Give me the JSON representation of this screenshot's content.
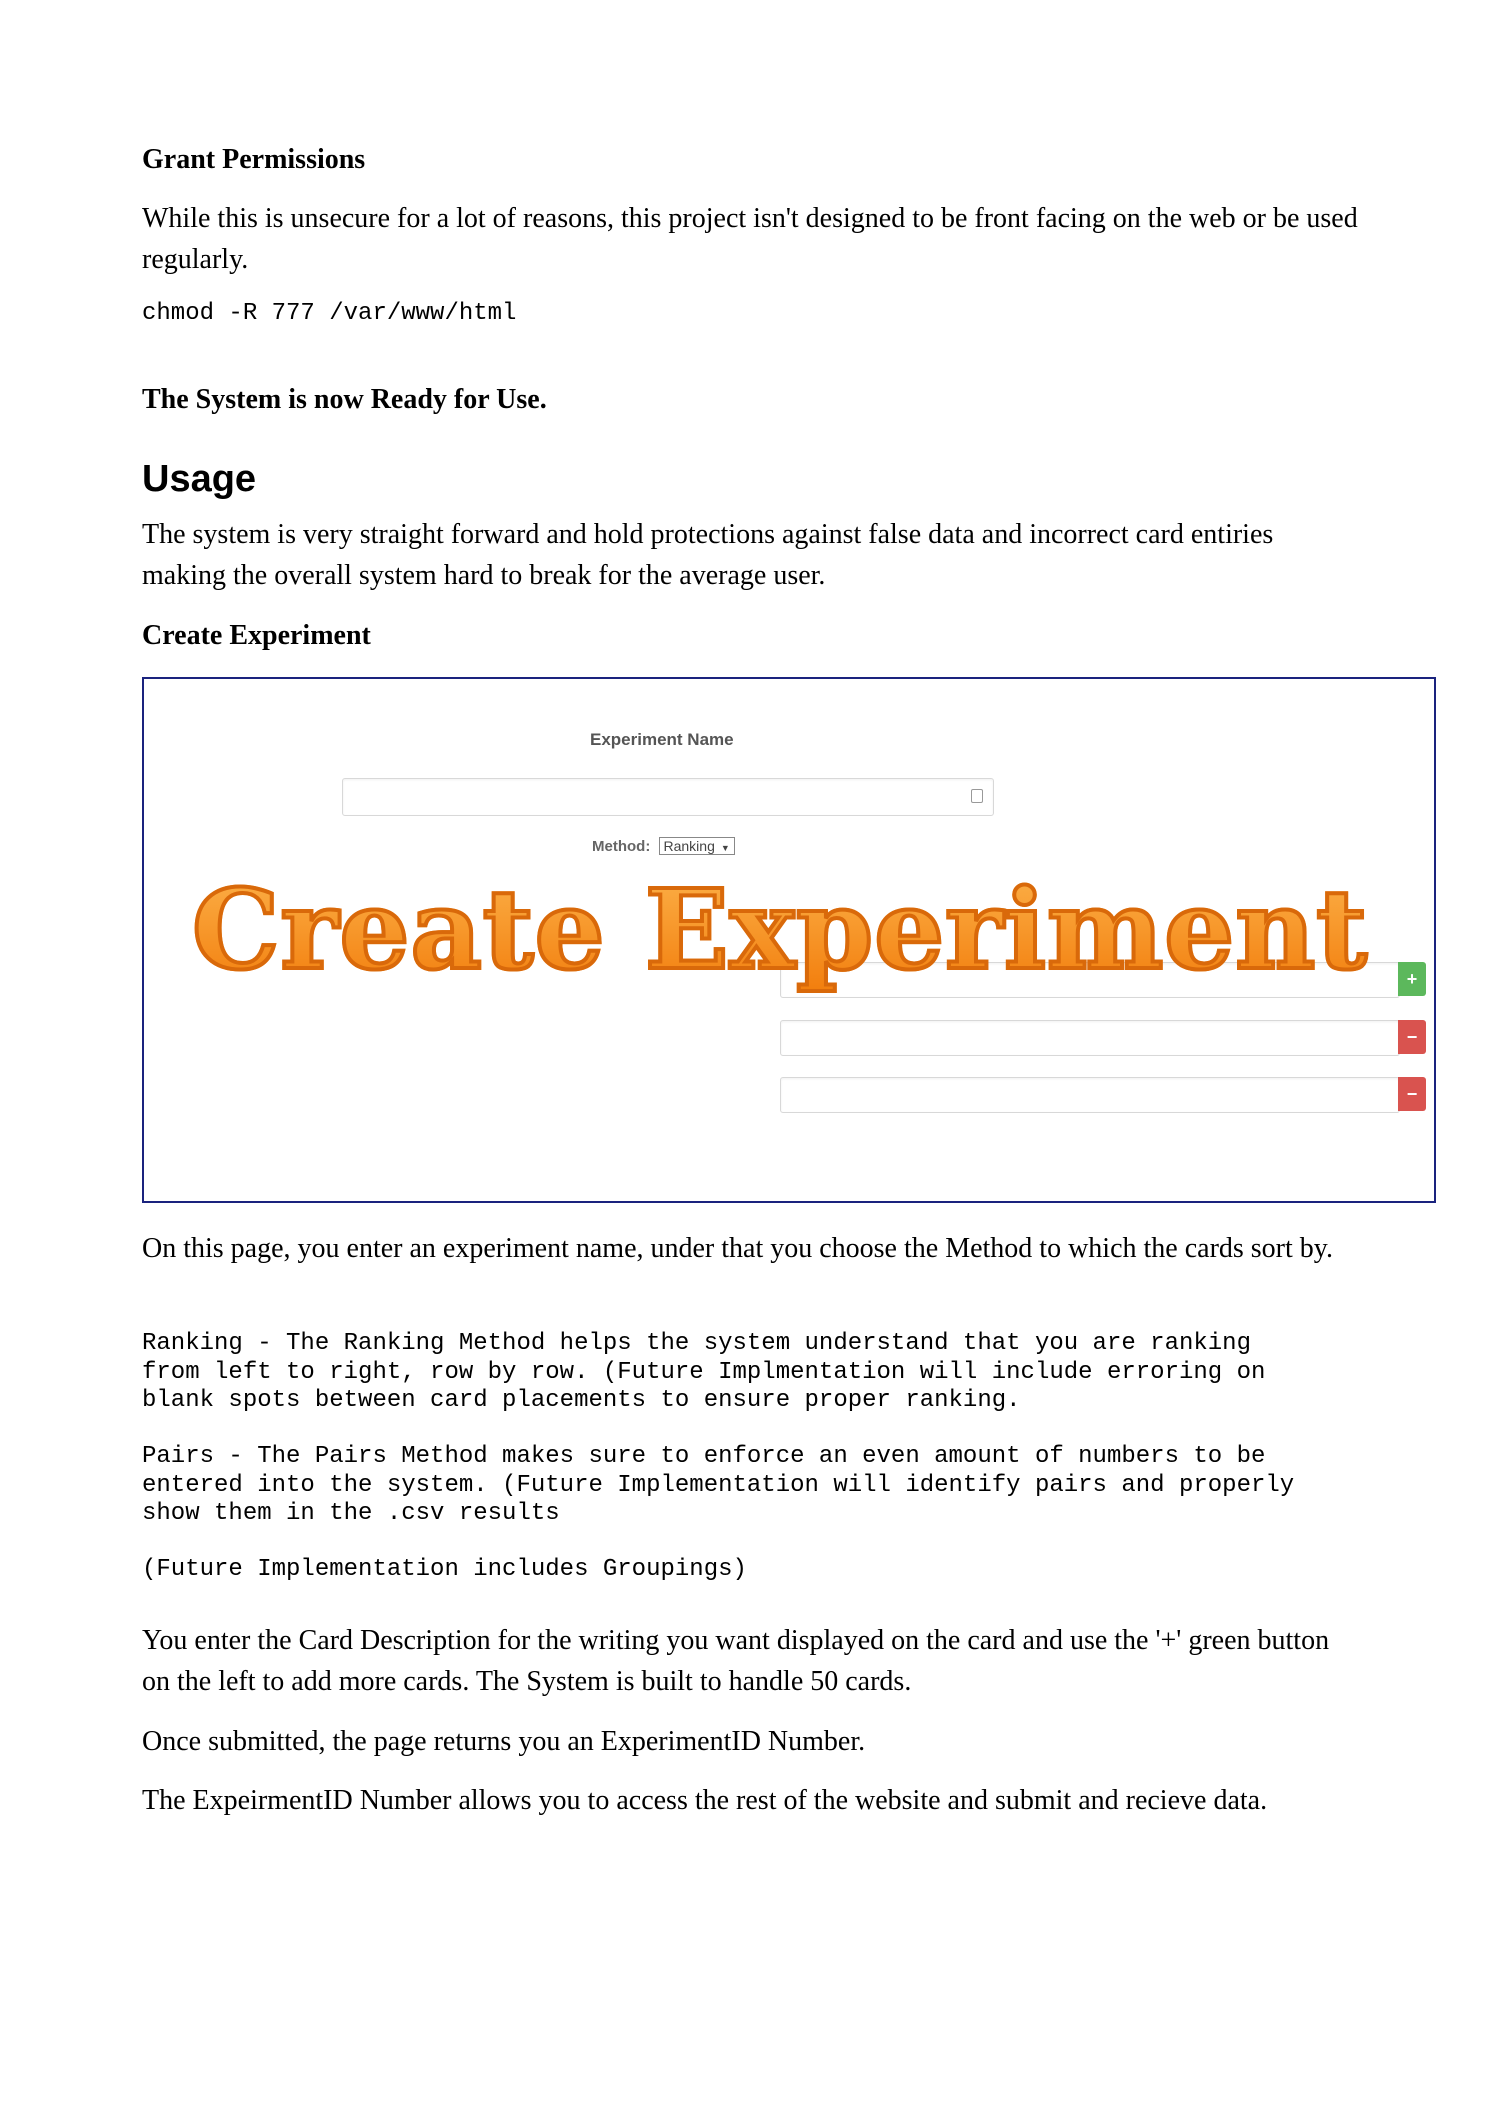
{
  "sections": {
    "grant_permissions_heading": "Grant Permissions",
    "grant_permissions_text": "While this is unsecure for a lot of reasons, this project isn't designed to be front facing on the web or be used regularly.",
    "chmod_command": "chmod -R 777 /var/www/html",
    "ready_text": "The System is now Ready for Use.",
    "usage_heading": "Usage",
    "usage_text": "The system is very straight forward and hold protections against false data and incorrect card entiries making the overall system hard to break for the average user.",
    "create_experiment_heading": "Create Experiment"
  },
  "figure": {
    "experiment_name_label": "Experiment Name",
    "method_label": "Method:",
    "method_selected": "Ranking",
    "overlay_title": "Create Experiment",
    "add_button": "+",
    "remove_button": "−"
  },
  "after_figure": {
    "page_intro": "On this page, you enter an experiment name, under that you choose the Method to which the cards sort by.",
    "ranking_text": "Ranking - The Ranking Method helps the system understand that you are ranking\nfrom left to right, row by row. (Future Implmentation will include erroring on\nblank spots between card placements to ensure proper ranking.",
    "pairs_text": "Pairs - The Pairs Method makes sure to enforce an even amount of numbers to be\nentered into the system. (Future Implementation will identify pairs and properly\nshow them in the .csv results",
    "groupings_text": "(Future Implementation includes Groupings)",
    "card_description_text": "You enter the Card Description for the writing you want displayed on the card and use the '+' green button on the left to add more cards. The System is built to handle 50 cards.",
    "submitted_text": "Once submitted, the page returns you an ExperimentID Number.",
    "experimentid_text": "The ExpeirmentID Number allows you to access the rest of the website and submit and recieve data."
  }
}
